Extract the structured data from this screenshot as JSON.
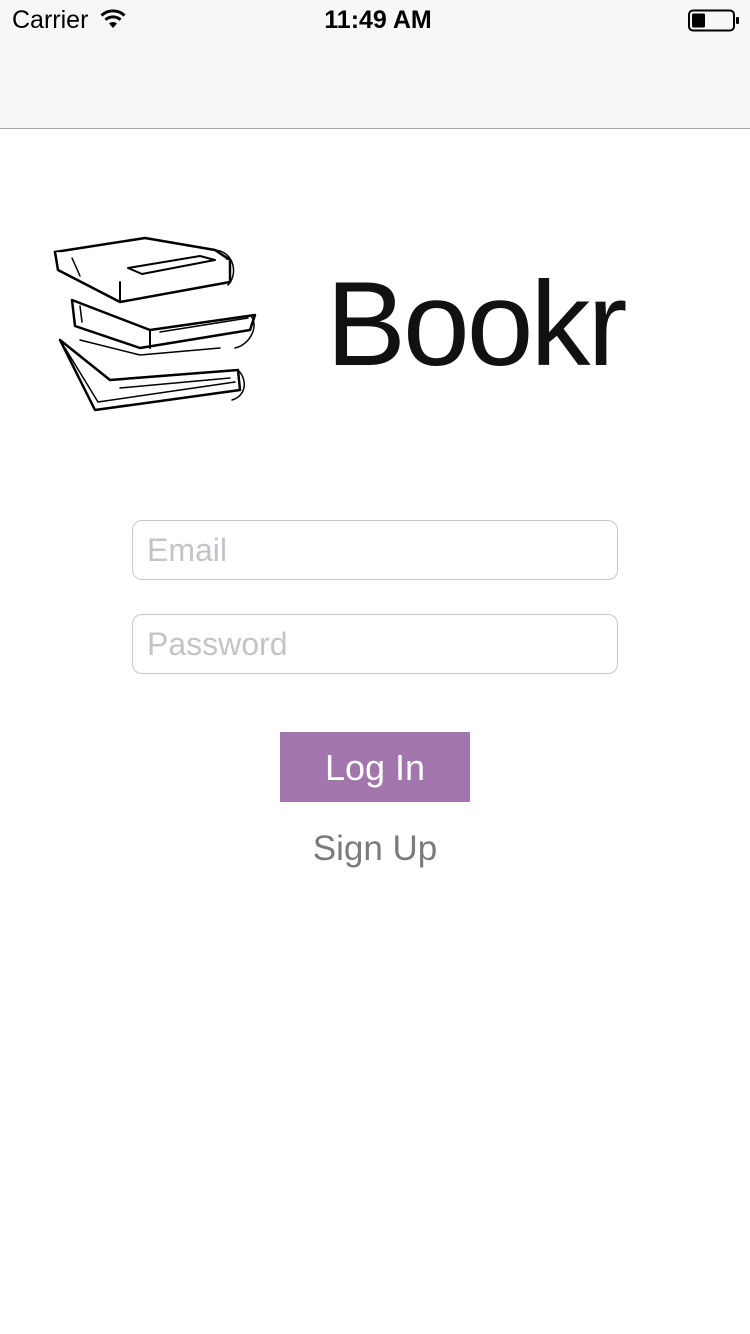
{
  "status_bar": {
    "carrier": "Carrier",
    "time": "11:49 AM",
    "wifi_icon": "wifi-icon",
    "battery_icon": "battery-icon",
    "battery_level": 0.3
  },
  "logo": {
    "icon": "books-stack-icon",
    "title": "Bookr"
  },
  "form": {
    "email": {
      "value": "",
      "placeholder": "Email"
    },
    "password": {
      "value": "",
      "placeholder": "Password"
    }
  },
  "actions": {
    "login_label": "Log In",
    "signup_label": "Sign Up"
  },
  "colors": {
    "accent": "#a276ac",
    "secondary_text": "#7b7b7b",
    "placeholder": "#c4c4c8",
    "bar_background": "#f7f7f7"
  }
}
